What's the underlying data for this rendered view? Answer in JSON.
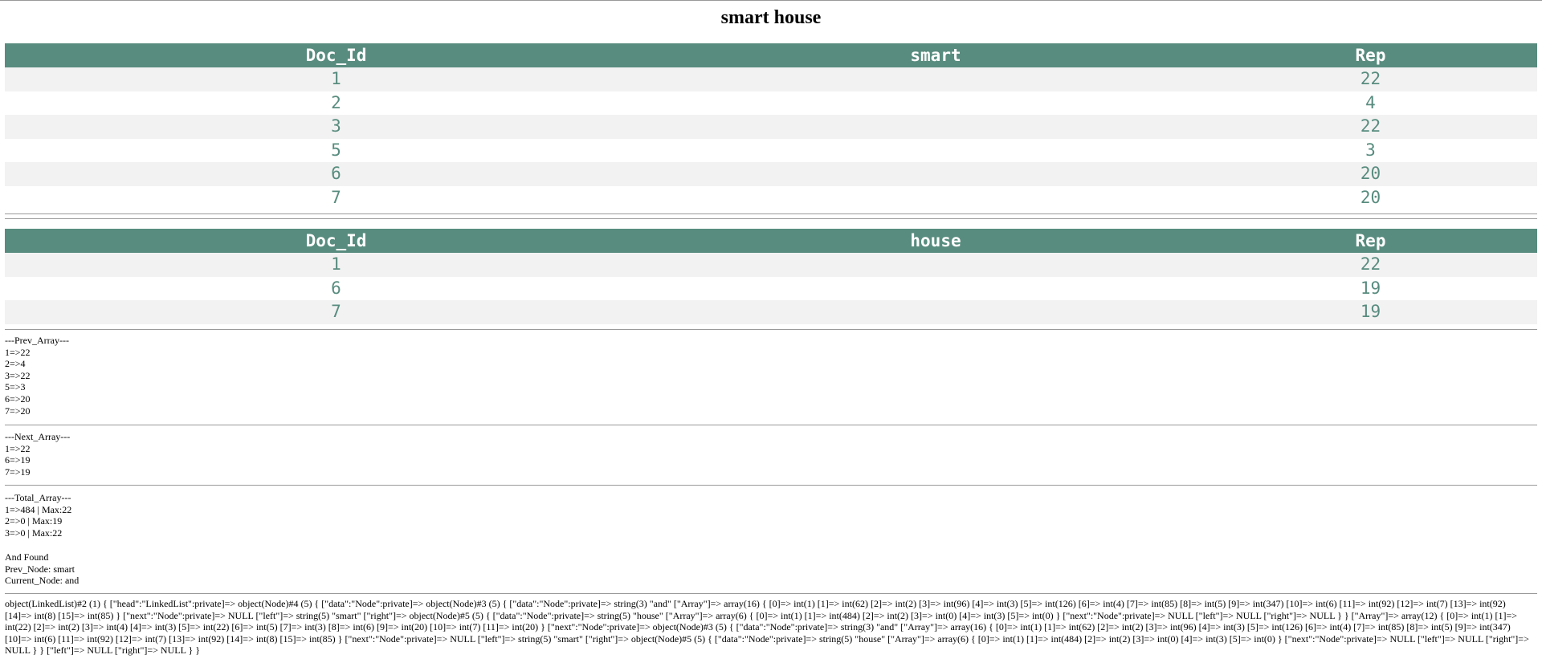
{
  "page": {
    "title": "smart house"
  },
  "table_smart": {
    "headers": [
      "Doc_Id",
      "smart",
      "Rep"
    ],
    "rows": [
      [
        "1",
        "",
        "22"
      ],
      [
        "2",
        "",
        "4"
      ],
      [
        "3",
        "",
        "22"
      ],
      [
        "5",
        "",
        "3"
      ],
      [
        "6",
        "",
        "20"
      ],
      [
        "7",
        "",
        "20"
      ]
    ]
  },
  "table_house": {
    "headers": [
      "Doc_Id",
      "house",
      "Rep"
    ],
    "rows": [
      [
        "1",
        "",
        "22"
      ],
      [
        "6",
        "",
        "19"
      ],
      [
        "7",
        "",
        "19"
      ]
    ]
  },
  "prev_array": {
    "heading": "---Prev_Array---",
    "lines": [
      "1=>22",
      "2=>4",
      "3=>22",
      "5=>3",
      "6=>20",
      "7=>20"
    ]
  },
  "next_array": {
    "heading": "---Next_Array---",
    "lines": [
      "1=>22",
      "6=>19",
      "7=>19"
    ]
  },
  "total_array": {
    "heading": "---Total_Array---",
    "lines": [
      "1=>484 | Max:22",
      "2=>0 | Max:19",
      "3=>0 | Max:22"
    ]
  },
  "status": {
    "found": "And Found",
    "prev_node": "Prev_Node: smart",
    "current_node": "Current_Node: and"
  },
  "var_dump": "object(LinkedList)#2 (1) { [\"head\":\"LinkedList\":private]=> object(Node)#4 (5) { [\"data\":\"Node\":private]=> object(Node)#3 (5) { [\"data\":\"Node\":private]=> string(3) \"and\" [\"Array\"]=> array(16) { [0]=> int(1) [1]=> int(62) [2]=> int(2) [3]=> int(96) [4]=> int(3) [5]=> int(126) [6]=> int(4) [7]=> int(85) [8]=> int(5) [9]=> int(347) [10]=> int(6) [11]=> int(92) [12]=> int(7) [13]=> int(92) [14]=> int(8) [15]=> int(85) } [\"next\":\"Node\":private]=> NULL [\"left\"]=> string(5) \"smart\" [\"right\"]=> object(Node)#5 (5) { [\"data\":\"Node\":private]=> string(5) \"house\" [\"Array\"]=> array(6) { [0]=> int(1) [1]=> int(484) [2]=> int(2) [3]=> int(0) [4]=> int(3) [5]=> int(0) } [\"next\":\"Node\":private]=> NULL [\"left\"]=> NULL [\"right\"]=> NULL } } [\"Array\"]=> array(12) { [0]=> int(1) [1]=> int(22) [2]=> int(2) [3]=> int(4) [4]=> int(3) [5]=> int(22) [6]=> int(5) [7]=> int(3) [8]=> int(6) [9]=> int(20) [10]=> int(7) [11]=> int(20) } [\"next\":\"Node\":private]=> object(Node)#3 (5) { [\"data\":\"Node\":private]=> string(3) \"and\" [\"Array\"]=> array(16) { [0]=> int(1) [1]=> int(62) [2]=> int(2) [3]=> int(96) [4]=> int(3) [5]=> int(126) [6]=> int(4) [7]=> int(85) [8]=> int(5) [9]=> int(347) [10]=> int(6) [11]=> int(92) [12]=> int(7) [13]=> int(92) [14]=> int(8) [15]=> int(85) } [\"next\":\"Node\":private]=> NULL [\"left\"]=> string(5) \"smart\" [\"right\"]=> object(Node)#5 (5) { [\"data\":\"Node\":private]=> string(5) \"house\" [\"Array\"]=> array(6) { [0]=> int(1) [1]=> int(484) [2]=> int(2) [3]=> int(0) [4]=> int(3) [5]=> int(0) } [\"next\":\"Node\":private]=> NULL [\"left\"]=> NULL [\"right\"]=> NULL } } [\"left\"]=> NULL [\"right\"]=> NULL } }"
}
